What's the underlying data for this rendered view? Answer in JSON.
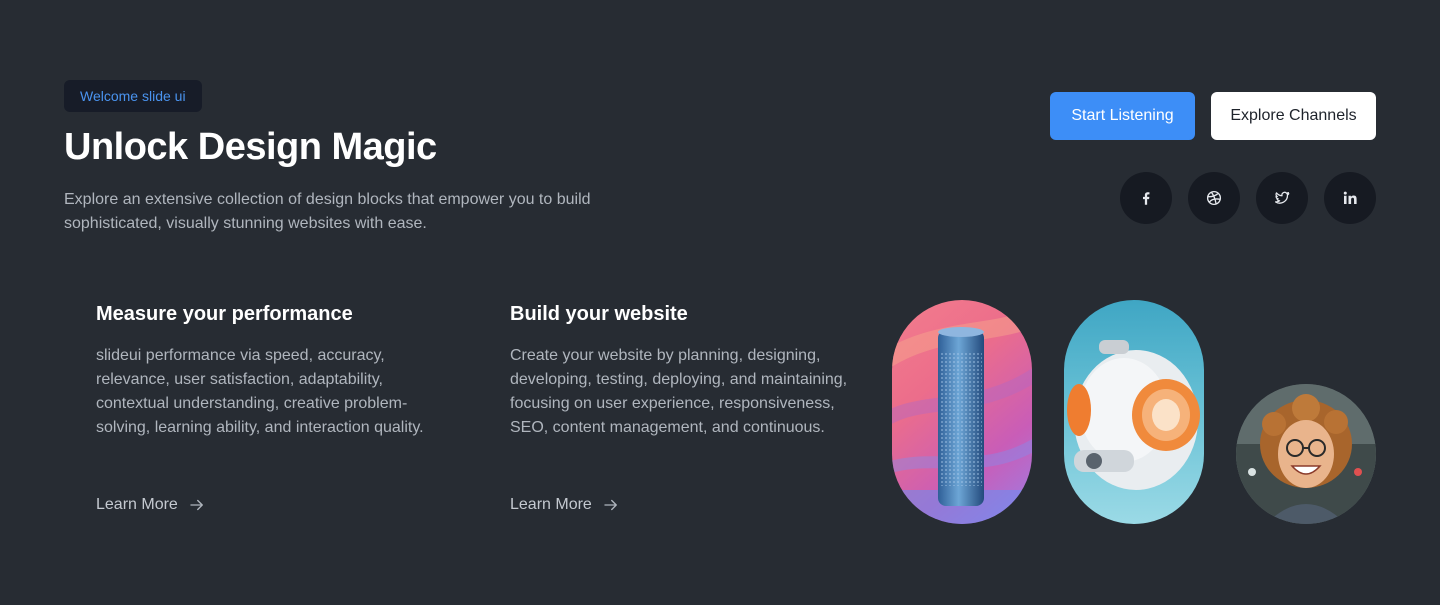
{
  "hero": {
    "badge": "Welcome slide ui",
    "title": "Unlock Design Magic",
    "subtitle": "Explore an extensive collection of design blocks that empower you to build sophisticated, visually stunning websites with ease."
  },
  "actions": {
    "primary_label": "Start Listening",
    "secondary_label": "Explore Channels"
  },
  "social": [
    "facebook-icon",
    "dribbble-icon",
    "twitter-icon",
    "linkedin-icon"
  ],
  "features": [
    {
      "title": "Measure your performance",
      "body": "slideui performance via speed, accuracy, relevance, user satisfaction, adaptability, contextual understanding, creative problem-solving, learning ability, and interaction quality.",
      "link": "Learn More"
    },
    {
      "title": "Build your website",
      "body": "Create your website by planning, designing, developing, testing, deploying, and maintaining, focusing on user experience, responsiveness, SEO, content management, and continuous.",
      "link": "Learn More"
    }
  ],
  "colors": {
    "background": "#272c33",
    "accent": "#3d8ef7",
    "badge_text": "#4a93ef"
  }
}
